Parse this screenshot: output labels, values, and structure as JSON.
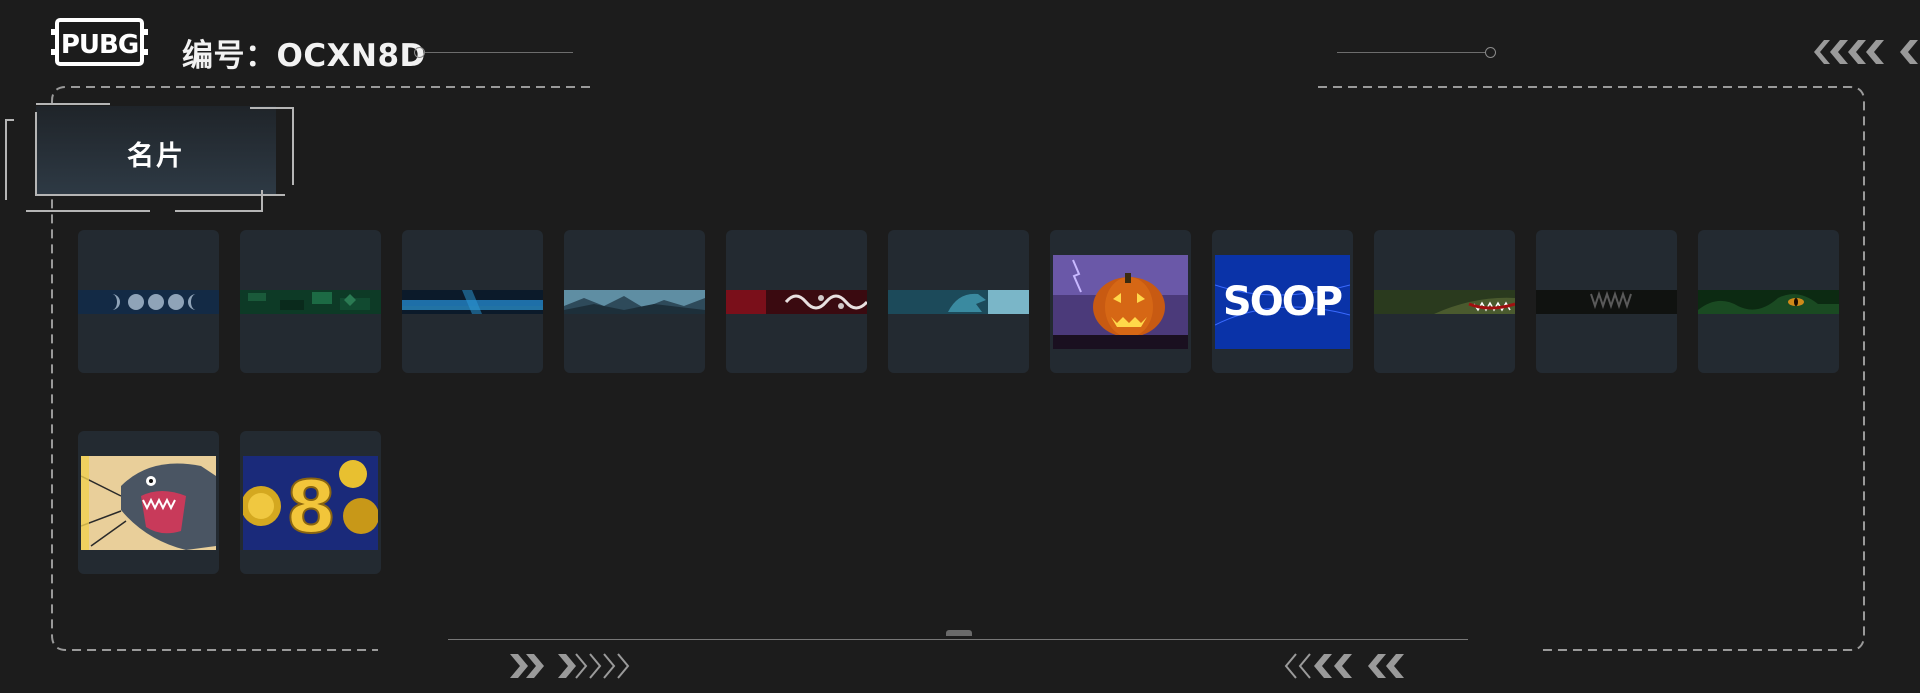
{
  "header": {
    "logo_text": "PUBG",
    "id_label": "编号：OCXN8D"
  },
  "tabs": [
    {
      "label": "名片",
      "active": true
    }
  ],
  "cards": [
    {
      "name": "moon-phases-banner",
      "kind": "banner"
    },
    {
      "name": "green-camo-banner",
      "kind": "banner"
    },
    {
      "name": "blue-stripe-banner",
      "kind": "banner"
    },
    {
      "name": "mountain-banner",
      "kind": "banner"
    },
    {
      "name": "red-dragon-banner",
      "kind": "banner"
    },
    {
      "name": "teal-wolf-banner",
      "kind": "banner"
    },
    {
      "name": "halloween-pumpkin-card",
      "kind": "tile"
    },
    {
      "name": "soop-card",
      "kind": "tile",
      "text": "SOOP"
    },
    {
      "name": "shark-mouth-banner",
      "kind": "banner"
    },
    {
      "name": "dark-teeth-banner",
      "kind": "banner"
    },
    {
      "name": "jungle-eye-banner",
      "kind": "banner"
    },
    {
      "name": "panther-card",
      "kind": "tile"
    },
    {
      "name": "gold-8-card",
      "kind": "tile",
      "text": "8"
    }
  ],
  "colors": {
    "background": "#1c1c1c",
    "card": "#232a31",
    "accent_text": "#f2f2f2",
    "frame_dash": "#9a9a9a",
    "arrow": "#8e8e8e"
  }
}
